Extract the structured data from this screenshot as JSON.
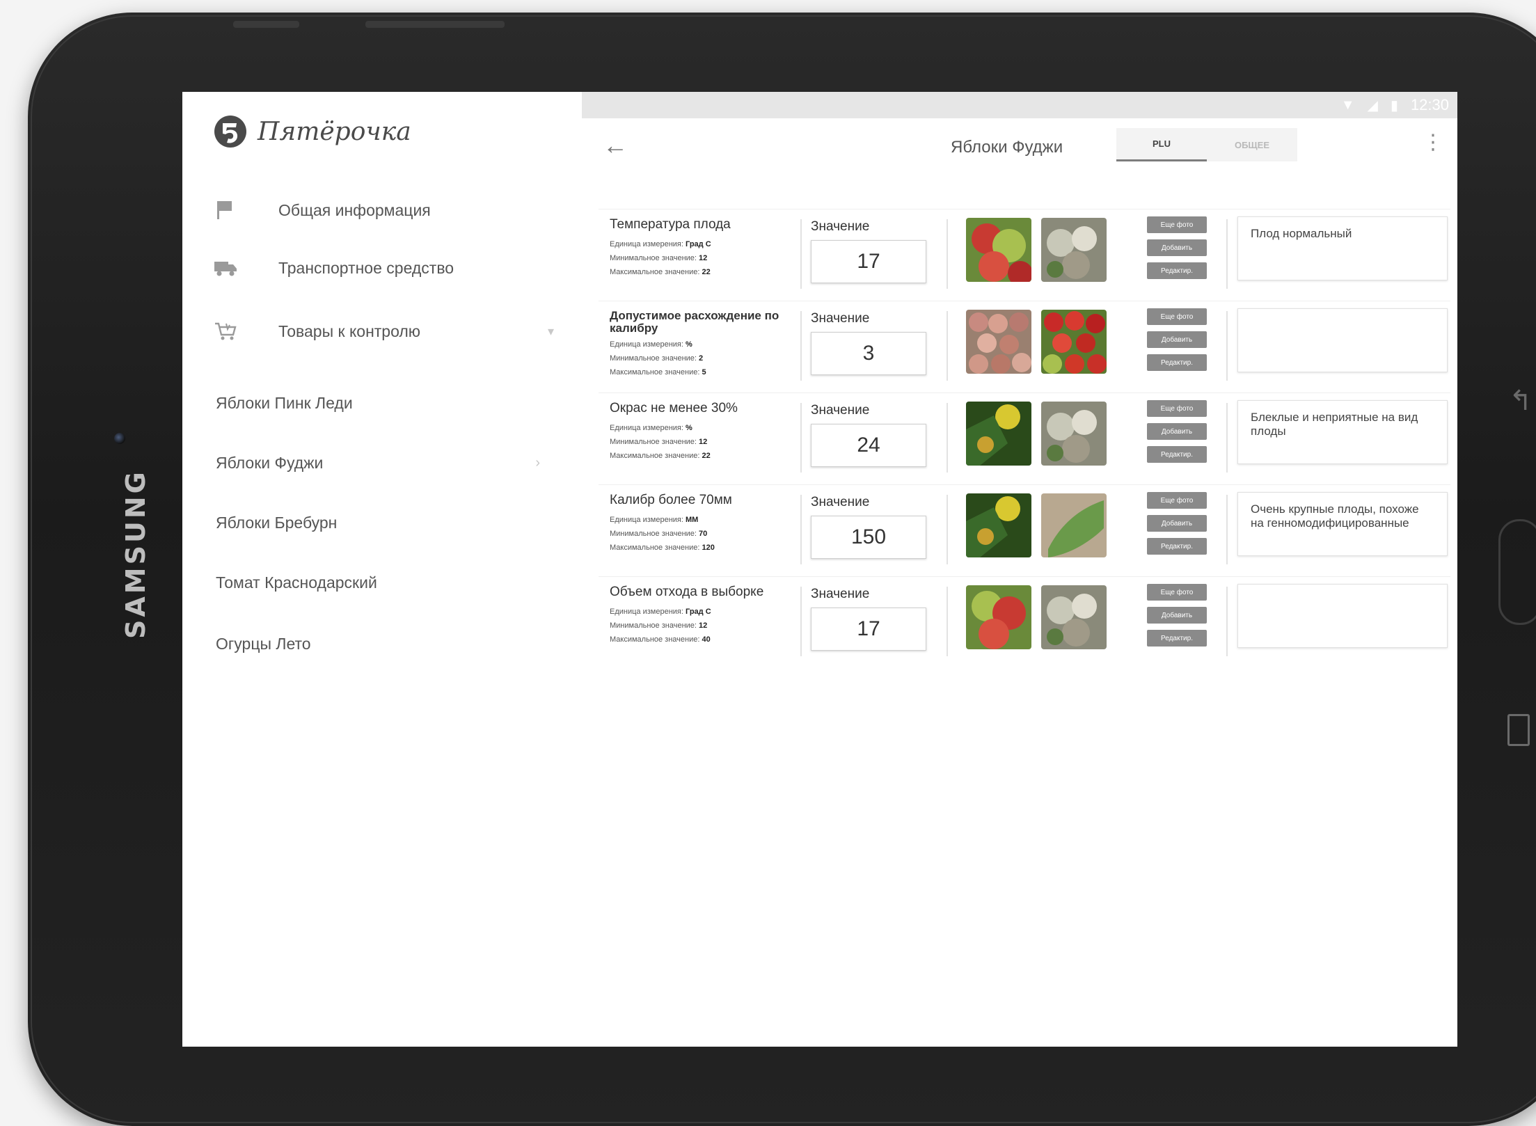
{
  "device": {
    "brand": "SAMSUNG"
  },
  "status_bar": {
    "time": "12:30"
  },
  "app": {
    "logo_text": "Пятёрочка"
  },
  "sidebar": {
    "menu": [
      {
        "label": "Общая информация",
        "icon": "flag-icon"
      },
      {
        "label": "Транспортное средство",
        "icon": "truck-icon"
      },
      {
        "label": "Товары к контролю",
        "icon": "cart-icon"
      }
    ],
    "products": [
      {
        "label": "Яблоки Пинк Леди"
      },
      {
        "label": "Яблоки Фуджи"
      },
      {
        "label": "Яблоки Бребурн"
      },
      {
        "label": "Томат Краснодарский"
      },
      {
        "label": "Огурцы Лето"
      }
    ]
  },
  "header": {
    "title": "Яблоки Фуджи",
    "tabs": [
      {
        "label": "PLU"
      },
      {
        "label": "ОБЩЕЕ"
      }
    ],
    "active_tab": "PLU"
  },
  "labels": {
    "value": "Значение",
    "unit": "Единица измерения:",
    "min": "Минимальное значение:",
    "max": "Максимальное значение:",
    "more_photo": "Еще фото",
    "add": "Добавить",
    "edit": "Редактир."
  },
  "criteria": [
    {
      "name": "Температура плода",
      "unit": "Град С",
      "min": "12",
      "max": "22",
      "value": "17",
      "comment": "Плод нормальный"
    },
    {
      "name": "Допустимое расхождение по калибру",
      "unit": "%",
      "min": "2",
      "max": "5",
      "value": "3",
      "comment": ""
    },
    {
      "name": "Окрас не менее 30%",
      "unit": "%",
      "min": "12",
      "max": "22",
      "value": "24",
      "comment": "Блеклые и неприятные на вид плоды"
    },
    {
      "name": "Калибр более 70мм",
      "unit": "ММ",
      "min": "70",
      "max": "120",
      "value": "150",
      "comment": "Очень крупные плоды, похоже на генномодифицированные"
    },
    {
      "name": "Объем отхода в выборке",
      "unit": "Град С",
      "min": "12",
      "max": "40",
      "value": "17",
      "comment": ""
    }
  ],
  "colors": {
    "accent_gray": "#8a8a8a",
    "status_bar": "#e6e6e6"
  }
}
